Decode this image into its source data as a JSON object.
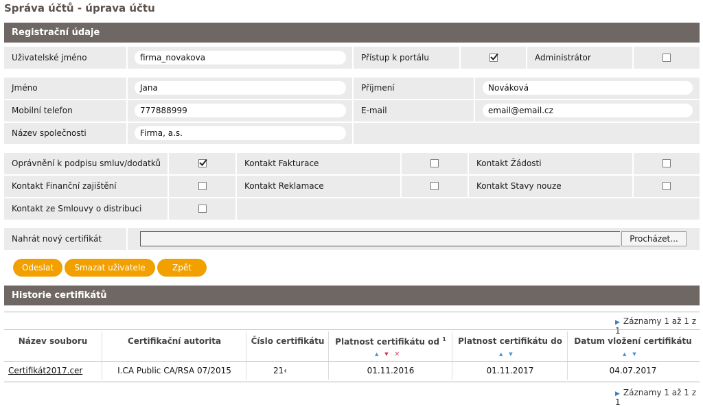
{
  "page": {
    "title": "Správa účtů - úprava účtu"
  },
  "registration": {
    "header": "Registrační údaje",
    "username_label": "Uživatelské jméno",
    "username_value": "firma_novakova",
    "portal_access_label": "Přístup k portálu",
    "portal_access_checked": true,
    "admin_label": "Administrátor",
    "admin_checked": false,
    "first_name_label": "Jméno",
    "first_name_value": "Jana",
    "last_name_label": "Příjmení",
    "last_name_value": "Nováková",
    "mobile_label": "Mobilní telefon",
    "mobile_value": "777888999",
    "email_label": "E-mail",
    "email_value": "email@email.cz",
    "company_label": "Název společnosti",
    "company_value": "Firma, a.s."
  },
  "permissions": {
    "sign_label": "Oprávnění k podpisu smluv/dodatků",
    "sign_checked": true,
    "billing_label": "Kontakt Fakturace",
    "billing_checked": false,
    "requests_label": "Kontakt Žádosti",
    "requests_checked": false,
    "financial_label": "Kontakt Finanční zajištění",
    "financial_checked": false,
    "complaints_label": "Kontakt Reklamace",
    "complaints_checked": false,
    "emergency_label": "Kontakt Stavy nouze",
    "emergency_checked": false,
    "distribution_label": "Kontakt ze Smlouvy o distribuci",
    "distribution_checked": false
  },
  "certificate_upload": {
    "label": "Nahrát nový certifikát",
    "file_value": "",
    "browse_label": "Procházet..."
  },
  "actions": {
    "submit_label": "Odeslat",
    "delete_label": "Smazat uživatele",
    "back_label": "Zpět"
  },
  "history": {
    "header": "Historie certifikátů",
    "pager_text": "Záznamy 1 až 1 z 1",
    "columns": [
      "Název souboru",
      "Certifikační autorita",
      "Číslo certifikátu",
      "Platnost certifikátu od",
      "Platnost certifikátu do",
      "Datum vložení certifikátu"
    ],
    "footnote_mark": "1",
    "rows": [
      {
        "file": "Certifikát2017.cer",
        "authority": "I.CA Public CA/RSA 07/2015",
        "number": "21‹",
        "valid_from": "01.11.2016",
        "valid_to": "01.11.2017",
        "inserted": "04.07.2017"
      }
    ]
  },
  "icons": {
    "check": "check-icon",
    "pager_arrow": "triangle-right-icon",
    "sort_asc": "triangle-up-icon",
    "sort_desc": "triangle-down-icon",
    "sort_clear": "x-icon"
  },
  "colors": {
    "header_bg": "#6e6763",
    "button_bg": "#f2a000",
    "cell_bg": "#ebebeb",
    "title": "#5a524d",
    "sort_accent": "#4a90d9",
    "sort_active": "#cc3355"
  }
}
